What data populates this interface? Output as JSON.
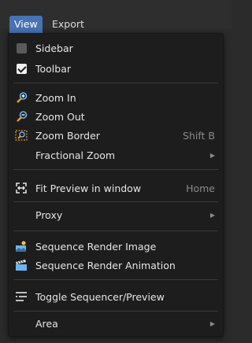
{
  "menubar": {
    "view": "View",
    "export": "Export"
  },
  "menu": {
    "sidebar": "Sidebar",
    "toolbar": "Toolbar",
    "zoom_in": "Zoom In",
    "zoom_out": "Zoom Out",
    "zoom_border": "Zoom Border",
    "zoom_border_shortcut": "Shift B",
    "fractional_zoom": "Fractional Zoom",
    "fit_preview": "Fit Preview in window",
    "fit_preview_shortcut": "Home",
    "proxy": "Proxy",
    "sequence_render_image": "Sequence Render Image",
    "sequence_render_animation": "Sequence Render Animation",
    "toggle_sequencer_preview": "Toggle Sequencer/Preview",
    "area": "Area"
  },
  "checkboxes": {
    "sidebar": false,
    "toolbar": true
  },
  "colors": {
    "accent": "#4772b3",
    "icon_orange": "#e8952e",
    "icon_blue": "#6cb4f0"
  }
}
